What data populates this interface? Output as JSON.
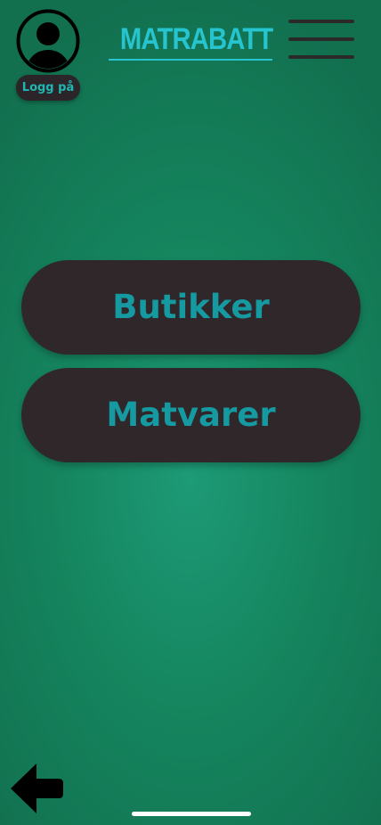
{
  "header": {
    "avatar_icon": "user-circle-icon",
    "login_label": "Logg på",
    "brand_title": "MATRABATT",
    "menu_icon": "hamburger-menu-icon"
  },
  "main": {
    "buttons": [
      {
        "label": "Butikker"
      },
      {
        "label": "Matvarer"
      }
    ]
  },
  "footer": {
    "back_icon": "arrow-left-icon"
  },
  "colors": {
    "background": "#1a9270",
    "button_bg": "#2f272a",
    "button_text": "#159aa1",
    "brand_text": "#25c4cf",
    "login_text": "#20b7b2"
  }
}
